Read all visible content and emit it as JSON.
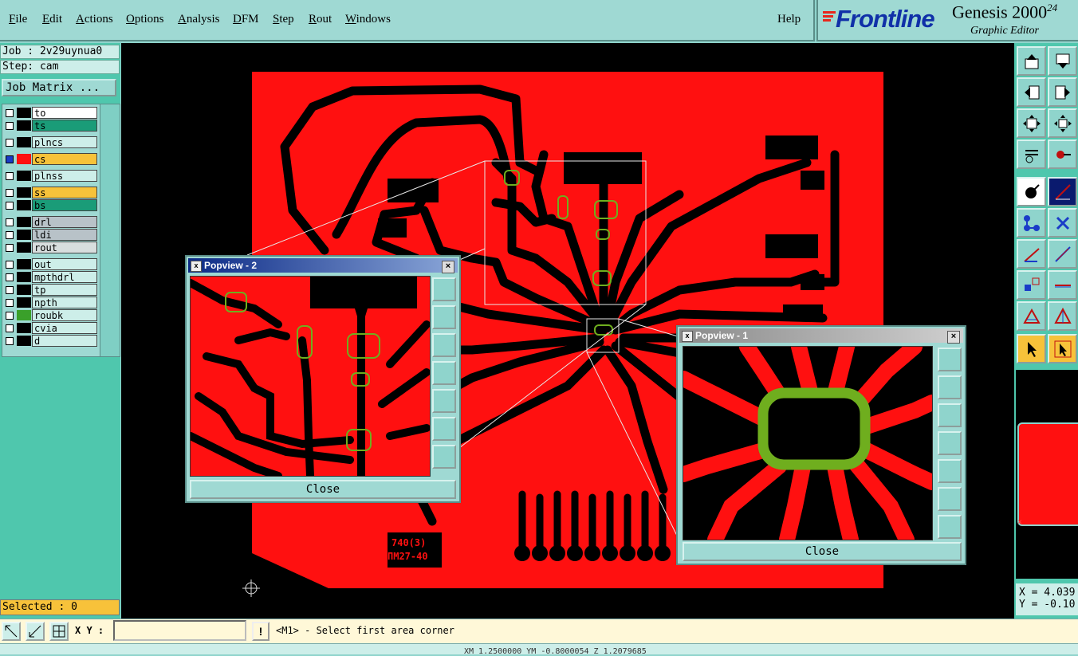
{
  "menubar": {
    "items": [
      {
        "label": "File",
        "u": "F",
        "rest": "ile"
      },
      {
        "label": "Edit",
        "u": "E",
        "rest": "dit"
      },
      {
        "label": "Actions",
        "u": "A",
        "rest": "ctions"
      },
      {
        "label": "Options",
        "u": "O",
        "rest": "ptions"
      },
      {
        "label": "Analysis",
        "u": "A",
        "rest": "nalysis"
      },
      {
        "label": "DFM",
        "u": "D",
        "rest": "FM"
      },
      {
        "label": "Step",
        "u": "S",
        "rest": "tep"
      },
      {
        "label": "Rout",
        "u": "R",
        "rest": "out"
      },
      {
        "label": "Windows",
        "u": "W",
        "rest": "indows"
      }
    ],
    "help": "Help"
  },
  "logo": {
    "brand": "Frontline",
    "product": "Genesis 2000",
    "sup": "24",
    "sub": "Graphic Editor"
  },
  "left": {
    "job": "Job : 2v29uynua0",
    "step": "Step: cam",
    "job_matrix": "Job Matrix ...",
    "layers": [
      {
        "name": "to",
        "bg": "#ffffff",
        "sw": "#000000"
      },
      {
        "name": "ts",
        "bg": "#1a9c78",
        "sw": "#000000"
      },
      {
        "name": "plncs",
        "bg": "#cdeee9",
        "sw": "#000000"
      },
      {
        "name": "cs",
        "bg": "#f7c23a",
        "sw": "#ff1010",
        "active": true
      },
      {
        "name": "plnss",
        "bg": "#cdeee9",
        "sw": "#000000"
      },
      {
        "name": "ss",
        "bg": "#f7c23a",
        "sw": "#000000"
      },
      {
        "name": "bs",
        "bg": "#1a9c78",
        "sw": "#000000"
      },
      {
        "name": "drl",
        "bg": "#b8c2c8",
        "sw": "#000000"
      },
      {
        "name": "ldi",
        "bg": "#b8c2c8",
        "sw": "#000000"
      },
      {
        "name": "rout",
        "bg": "#d8dede",
        "sw": "#000000"
      },
      {
        "name": "out",
        "bg": "#cdeee9",
        "sw": "#000000"
      },
      {
        "name": "mpthdrl",
        "bg": "#cdeee9",
        "sw": "#000000"
      },
      {
        "name": "tp",
        "bg": "#cdeee9",
        "sw": "#000000"
      },
      {
        "name": "npth",
        "bg": "#cdeee9",
        "sw": "#000000"
      },
      {
        "name": "roubk",
        "bg": "#cdeee9",
        "sw": "#3aa02a"
      },
      {
        "name": "cvia",
        "bg": "#cdeee9",
        "sw": "#000000"
      },
      {
        "name": "d",
        "bg": "#cdeee9",
        "sw": "#000000"
      }
    ],
    "selected": "Selected : 0"
  },
  "board": {
    "marking_line1": "740(3)",
    "marking_line2": "ПМ27-40"
  },
  "popup2": {
    "title": "Popview - 2",
    "close": "Close"
  },
  "popup1": {
    "title": "Popview - 1",
    "close": "Close"
  },
  "coords": {
    "x": "X = 4.039",
    "y": "Y = -0.10"
  },
  "bottom": {
    "xy_label": "X Y :",
    "xy_value": "",
    "prompt": "<M1> - Select first area corner"
  },
  "status": "XM 1.2500000  YM -0.8000054  Z 1.2079685",
  "colors": {
    "copper": "#ff1010",
    "background": "#000000",
    "highlight": "#6fae1e",
    "panel": "#9fd9d3"
  }
}
